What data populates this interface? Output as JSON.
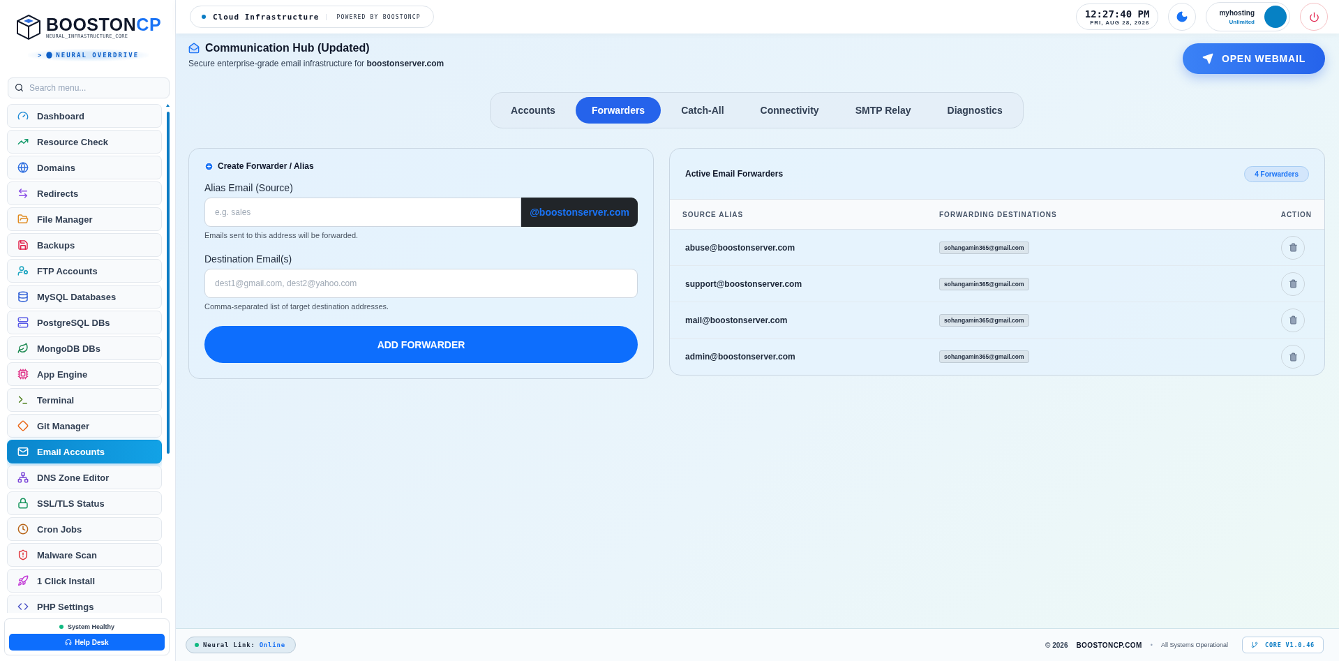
{
  "brand": {
    "name": "BOOSTON",
    "name_accent": "CP",
    "tagline": "NEURAL_INFRASTRUCTURE_CORE",
    "mode_prompt": ">",
    "mode": "NEURAL OVERDRIVE"
  },
  "sidebar": {
    "search": {
      "placeholder": "Search menu..."
    },
    "items": [
      {
        "label": "Dashboard",
        "selected": false
      },
      {
        "label": "Resource Check",
        "selected": false
      },
      {
        "label": "Domains",
        "selected": false
      },
      {
        "label": "Redirects",
        "selected": false
      },
      {
        "label": "File Manager",
        "selected": false
      },
      {
        "label": "Backups",
        "selected": false
      },
      {
        "label": "FTP Accounts",
        "selected": false
      },
      {
        "label": "MySQL Databases",
        "selected": false
      },
      {
        "label": "PostgreSQL DBs",
        "selected": false
      },
      {
        "label": "MongoDB DBs",
        "selected": false
      },
      {
        "label": "App Engine",
        "selected": false
      },
      {
        "label": "Terminal",
        "selected": false
      },
      {
        "label": "Git Manager",
        "selected": false
      },
      {
        "label": "Email Accounts",
        "selected": true
      },
      {
        "label": "DNS Zone Editor",
        "selected": false
      },
      {
        "label": "SSL/TLS Status",
        "selected": false
      },
      {
        "label": "Cron Jobs",
        "selected": false
      },
      {
        "label": "Malware Scan",
        "selected": false
      },
      {
        "label": "1 Click Install",
        "selected": false
      },
      {
        "label": "PHP Settings",
        "selected": false
      }
    ],
    "status": {
      "label": "System Healthy",
      "healthy": true
    },
    "help_button": "Help Desk"
  },
  "topbar": {
    "context": "Cloud Infrastructure",
    "powered_by": "POWERED BY BOOSTONCP",
    "time": "12:27:40 PM",
    "date": "FRI, AUG 28, 2026",
    "user": "myhosting",
    "plan": "Unlimited"
  },
  "page": {
    "title": "Communication Hub (Updated)",
    "subtitle": "Secure enterprise-grade email infrastructure for **boostonserver.com**",
    "webmail_button": "OPEN WEBMAIL"
  },
  "tabs": [
    {
      "label": "Accounts",
      "selected": false
    },
    {
      "label": "Forwarders",
      "selected": true
    },
    {
      "label": "Catch-All",
      "selected": false
    },
    {
      "label": "Connectivity",
      "selected": false
    },
    {
      "label": "SMTP Relay",
      "selected": false
    },
    {
      "label": "Diagnostics",
      "selected": false
    }
  ],
  "create_form": {
    "title": "Create Forwarder / Alias",
    "alias": {
      "label": "Alias Email (Source)",
      "placeholder": "e.g. sales",
      "suffix": "@boostonserver.com",
      "hint": "Emails sent to this address will be forwarded."
    },
    "destination": {
      "label": "Destination Email(s)",
      "placeholder": "dest1@gmail.com, dest2@yahoo.com",
      "hint": "Comma-separated list of target destination addresses."
    },
    "submit": "ADD FORWARDER"
  },
  "forwarders": {
    "title": "Active Email Forwarders",
    "count": "4 Forwarders",
    "columns": [
      "SOURCE ALIAS",
      "FORWARDING DESTINATIONS",
      "ACTION"
    ],
    "rows": [
      {
        "source": "abuse@boostonserver.com",
        "destination": "sohangamin365@gmail.com"
      },
      {
        "source": "support@boostonserver.com",
        "destination": "sohangamin365@gmail.com"
      },
      {
        "source": "mail@boostonserver.com",
        "destination": "sohangamin365@gmail.com"
      },
      {
        "source": "admin@boostonserver.com",
        "destination": "sohangamin365@gmail.com"
      }
    ]
  },
  "footer": {
    "link_label": "Neural Link:",
    "link_status": "Online",
    "copyright": "© 2026",
    "copyright_brand": "BOOSTONCP.COM",
    "separator": "•",
    "system_status": "All Systems Operational",
    "version": "CORE V1.0.46"
  }
}
